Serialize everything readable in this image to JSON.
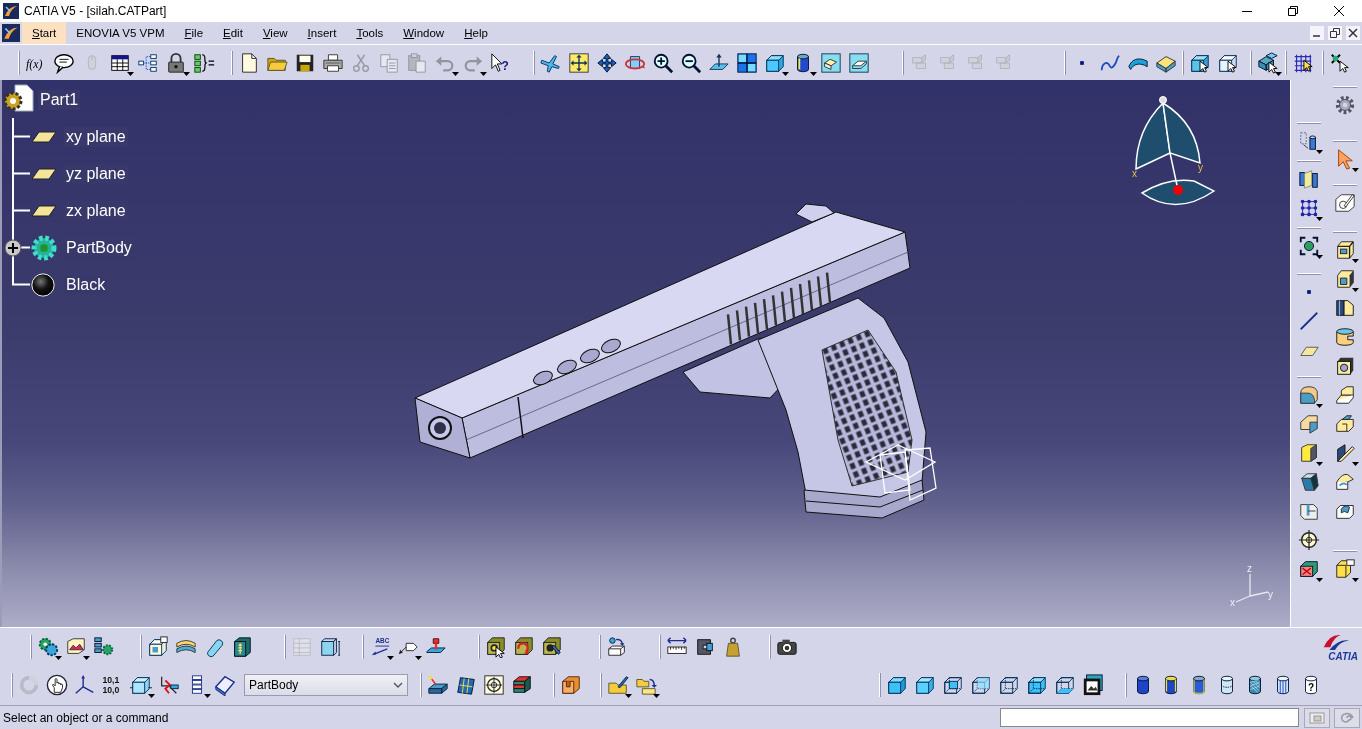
{
  "window": {
    "title": "CATIA V5 - [silah.CATPart]"
  },
  "menu_bar": [
    {
      "label": "Start",
      "selected": true,
      "access_key": true
    },
    {
      "label": "ENOVIA V5 VPM",
      "selected": false,
      "access_key": false
    },
    {
      "label": "File",
      "selected": false,
      "access_key": true
    },
    {
      "label": "Edit",
      "selected": false,
      "access_key": true
    },
    {
      "label": "View",
      "selected": false,
      "access_key": true
    },
    {
      "label": "Insert",
      "selected": false,
      "access_key": true
    },
    {
      "label": "Tools",
      "selected": false,
      "access_key": true
    },
    {
      "label": "Window",
      "selected": false,
      "access_key": true
    },
    {
      "label": "Help",
      "selected": false,
      "access_key": true
    }
  ],
  "toolbar_top": [
    {
      "items": [
        {
          "kind": "formula",
          "label": "f(x)",
          "flyout": false,
          "disabled": false
        },
        {
          "kind": "comment",
          "flyout": false,
          "disabled": false
        },
        {
          "kind": "mouse",
          "flyout": false,
          "disabled": true
        },
        {
          "kind": "table",
          "flyout": true,
          "disabled": false
        },
        {
          "kind": "graph",
          "flyout": false,
          "disabled": false
        },
        {
          "kind": "lock",
          "flyout": true,
          "disabled": false
        },
        {
          "kind": "braces",
          "flyout": false,
          "disabled": false
        }
      ]
    },
    {
      "items": [
        {
          "kind": "new",
          "flyout": false,
          "disabled": false
        },
        {
          "kind": "open",
          "flyout": false,
          "disabled": false
        },
        {
          "kind": "save",
          "flyout": false,
          "disabled": false
        },
        {
          "kind": "print",
          "flyout": false,
          "disabled": false
        },
        {
          "kind": "cut",
          "flyout": false,
          "disabled": true
        },
        {
          "kind": "copy",
          "flyout": false,
          "disabled": true
        },
        {
          "kind": "paste",
          "flyout": false,
          "disabled": true
        },
        {
          "kind": "undo",
          "flyout": true,
          "disabled": true
        },
        {
          "kind": "redo",
          "flyout": true,
          "disabled": true
        },
        {
          "kind": "help",
          "label": "?",
          "flyout": false,
          "disabled": false
        }
      ]
    },
    {
      "items": [
        {
          "kind": "fly",
          "flyout": false,
          "disabled": false
        },
        {
          "kind": "fitall",
          "flyout": false,
          "disabled": false
        },
        {
          "kind": "pan",
          "flyout": false,
          "disabled": false
        },
        {
          "kind": "rotate",
          "flyout": false,
          "disabled": false
        },
        {
          "kind": "zoomin",
          "flyout": false,
          "disabled": false
        },
        {
          "kind": "zoomout",
          "flyout": false,
          "disabled": false
        },
        {
          "kind": "normal",
          "flyout": false,
          "disabled": false
        },
        {
          "kind": "multiview",
          "flyout": false,
          "disabled": false
        },
        {
          "kind": "iso",
          "flyout": true,
          "disabled": false
        },
        {
          "kind": "shading",
          "flyout": true,
          "disabled": false
        },
        {
          "kind": "hide",
          "flyout": false,
          "disabled": false
        },
        {
          "kind": "swap",
          "flyout": false,
          "disabled": false
        }
      ]
    },
    {
      "items": [
        {
          "kind": "blocks",
          "flyout": false,
          "disabled": true
        },
        {
          "kind": "blocks",
          "flyout": false,
          "disabled": true
        },
        {
          "kind": "blocks",
          "flyout": false,
          "disabled": true
        },
        {
          "kind": "blocks",
          "flyout": false,
          "disabled": true
        }
      ]
    },
    {
      "items": [
        {
          "kind": "point",
          "flyout": false,
          "disabled": false
        },
        {
          "kind": "curve",
          "flyout": false,
          "disabled": false
        },
        {
          "kind": "surface",
          "flyout": false,
          "disabled": false
        },
        {
          "kind": "solid",
          "flyout": false,
          "disabled": false
        }
      ]
    },
    {
      "items": [
        {
          "kind": "selbox",
          "flyout": false,
          "disabled": false
        },
        {
          "kind": "selbox2",
          "flyout": false,
          "disabled": false
        }
      ]
    },
    {
      "items": [
        {
          "kind": "assembly",
          "flyout": true,
          "disabled": false
        }
      ]
    },
    {
      "items": [
        {
          "kind": "gridsel",
          "flyout": false,
          "disabled": false
        }
      ]
    },
    {
      "items": [
        {
          "kind": "sparkle",
          "flyout": false,
          "disabled": false
        }
      ]
    }
  ],
  "tree": {
    "label": "Part1",
    "kind": "part",
    "children": [
      {
        "label": "xy plane",
        "kind": "plane",
        "collapsed": false
      },
      {
        "label": "yz plane",
        "kind": "plane",
        "collapsed": false
      },
      {
        "label": "zx plane",
        "kind": "plane",
        "collapsed": false
      },
      {
        "label": "PartBody",
        "kind": "body",
        "collapsed": true
      },
      {
        "label": "Black",
        "kind": "material",
        "collapsed": false
      }
    ]
  },
  "viewport": {
    "compass_labels": [
      "x",
      "y"
    ],
    "axis_labels": [
      "z",
      "x",
      "y"
    ]
  },
  "toolbar_right": {
    "left_column": [
      {
        "items": [
          {
            "kind": "dottedcyl",
            "flyout": true,
            "disabled": false
          }
        ]
      },
      {
        "items": [
          {
            "kind": "cylplane",
            "flyout": false,
            "disabled": false
          },
          {
            "kind": "dotgrid",
            "flyout": true,
            "disabled": false
          }
        ]
      },
      {
        "items": [
          {
            "kind": "bbox",
            "flyout": true,
            "disabled": false
          }
        ]
      },
      {
        "items": [
          {
            "kind": "point",
            "flyout": false,
            "disabled": false
          },
          {
            "kind": "line",
            "flyout": false,
            "disabled": false
          },
          {
            "kind": "plane",
            "flyout": false,
            "disabled": false
          }
        ]
      },
      {
        "items": [
          {
            "kind": "shell",
            "flyout": true,
            "disabled": false
          },
          {
            "kind": "chamfer",
            "flyout": false,
            "disabled": false
          },
          {
            "kind": "yblock",
            "flyout": true,
            "disabled": false
          },
          {
            "kind": "draft",
            "flyout": false,
            "disabled": false
          },
          {
            "kind": "split",
            "flyout": false,
            "disabled": false
          },
          {
            "kind": "target",
            "flyout": false,
            "disabled": false
          },
          {
            "kind": "redx",
            "flyout": true,
            "disabled": false
          }
        ]
      }
    ],
    "right_column": [
      {
        "items": [
          {
            "kind": "gear",
            "flyout": false,
            "disabled": false
          }
        ]
      },
      {
        "items": [
          {
            "kind": "cursor",
            "flyout": true,
            "disabled": false
          }
        ]
      },
      {
        "items": [
          {
            "kind": "sketch",
            "flyout": false,
            "disabled": false
          }
        ]
      },
      {
        "items": [
          {
            "kind": "pad",
            "flyout": true,
            "disabled": false
          },
          {
            "kind": "pocket",
            "flyout": true,
            "disabled": false
          },
          {
            "kind": "shaft",
            "flyout": false,
            "disabled": false
          },
          {
            "kind": "groove",
            "flyout": false,
            "disabled": false
          },
          {
            "kind": "hole",
            "flyout": false,
            "disabled": false
          },
          {
            "kind": "rib",
            "flyout": false,
            "disabled": false
          },
          {
            "kind": "slot",
            "flyout": false,
            "disabled": false
          },
          {
            "kind": "stiffener",
            "flyout": true,
            "disabled": false
          },
          {
            "kind": "loft",
            "flyout": false,
            "disabled": false
          },
          {
            "kind": "rloft",
            "flyout": false,
            "disabled": false
          }
        ]
      },
      {
        "items": [
          {
            "kind": "tagbox",
            "flyout": true,
            "disabled": false
          }
        ]
      }
    ]
  },
  "toolbar_bottom": {
    "row_1": [
      {
        "items": [
          {
            "kind": "gears",
            "flyout": true,
            "disabled": false
          },
          {
            "kind": "landscape",
            "flyout": true,
            "disabled": false
          },
          {
            "kind": "listgear",
            "flyout": false,
            "disabled": false
          }
        ]
      },
      {
        "items": [
          {
            "kind": "boxtag",
            "flyout": false,
            "disabled": false
          },
          {
            "kind": "layers",
            "flyout": false,
            "disabled": false
          },
          {
            "kind": "capsule",
            "flyout": false,
            "disabled": false
          },
          {
            "kind": "panel",
            "flyout": false,
            "disabled": false
          }
        ]
      },
      {
        "items": [
          {
            "kind": "tablegrid",
            "flyout": false,
            "disabled": true
          },
          {
            "kind": "dimbox",
            "flyout": false,
            "disabled": false
          }
        ]
      },
      {
        "items": [
          {
            "kind": "abc",
            "label": "ABC",
            "flyout": true,
            "disabled": false
          },
          {
            "kind": "flag",
            "flyout": true,
            "disabled": false
          },
          {
            "kind": "stamp",
            "flyout": false,
            "disabled": false
          }
        ]
      },
      {
        "items": [
          {
            "kind": "olive1",
            "flyout": false,
            "disabled": false
          },
          {
            "kind": "olive2",
            "flyout": false,
            "disabled": false
          },
          {
            "kind": "olive3",
            "flyout": false,
            "disabled": false
          }
        ]
      },
      {
        "items": [
          {
            "kind": "movebox",
            "flyout": false,
            "disabled": false
          }
        ]
      },
      {
        "items": [
          {
            "kind": "ruler",
            "flyout": false,
            "disabled": false
          },
          {
            "kind": "inertia",
            "flyout": false,
            "disabled": false
          },
          {
            "kind": "weight",
            "flyout": false,
            "disabled": false
          }
        ]
      },
      {
        "items": [
          {
            "kind": "camera",
            "flyout": false,
            "disabled": false
          }
        ]
      }
    ],
    "row_2": [
      {
        "items": [
          {
            "kind": "update",
            "flyout": false,
            "disabled": true
          },
          {
            "kind": "hand",
            "flyout": false,
            "disabled": false
          },
          {
            "kind": "axes",
            "flyout": false,
            "disabled": false
          },
          {
            "kind": "numbers",
            "lines": [
              "10,1",
              "10,0"
            ],
            "flyout": false,
            "disabled": false
          },
          {
            "kind": "cubearrows",
            "flyout": true,
            "disabled": false
          },
          {
            "kind": "redaxis",
            "flyout": false,
            "disabled": false
          },
          {
            "kind": "listlines",
            "flyout": true,
            "disabled": false
          },
          {
            "kind": "planebook",
            "flyout": false,
            "disabled": false
          }
        ],
        "selector": {
          "value": "PartBody"
        }
      },
      {
        "items": [
          {
            "kind": "laser",
            "flyout": false,
            "disabled": false
          },
          {
            "kind": "mesh",
            "flyout": false,
            "disabled": false
          },
          {
            "kind": "targetgrid",
            "flyout": false,
            "disabled": false
          },
          {
            "kind": "sandwich",
            "flyout": false,
            "disabled": false
          }
        ]
      },
      {
        "items": [
          {
            "kind": "orange",
            "flyout": false,
            "disabled": false
          }
        ]
      },
      {
        "items": [
          {
            "kind": "folderpen",
            "flyout": true,
            "disabled": false
          },
          {
            "kind": "folderarrow",
            "flyout": true,
            "disabled": false
          }
        ]
      },
      {
        "items": [
          {
            "kind": "shaded",
            "flyout": false,
            "disabled": false
          },
          {
            "kind": "edged",
            "flyout": false,
            "disabled": false
          },
          {
            "kind": "nested",
            "flyout": false,
            "disabled": false
          },
          {
            "kind": "halfshaded",
            "flyout": false,
            "disabled": false
          },
          {
            "kind": "wireframe",
            "flyout": false,
            "disabled": false
          },
          {
            "kind": "openfront",
            "flyout": false,
            "disabled": false
          },
          {
            "kind": "baseshaded",
            "flyout": false,
            "disabled": false
          },
          {
            "kind": "photo",
            "flyout": false,
            "disabled": false
          }
        ]
      },
      {
        "items": [
          {
            "kind": "cylsolid",
            "flyout": false,
            "disabled": false
          },
          {
            "kind": "cylrim",
            "flyout": false,
            "disabled": false
          },
          {
            "kind": "cylframed",
            "flyout": false,
            "disabled": false
          },
          {
            "kind": "cyllight",
            "flyout": false,
            "disabled": false
          },
          {
            "kind": "cylhatch",
            "flyout": false,
            "disabled": false
          },
          {
            "kind": "cylwire",
            "flyout": false,
            "disabled": false
          },
          {
            "kind": "cylhelp",
            "label": "?",
            "flyout": false,
            "disabled": false
          }
        ]
      }
    ]
  },
  "brand": {
    "label": "CATIA"
  },
  "status_bar": {
    "message": "Select an object or a command"
  }
}
